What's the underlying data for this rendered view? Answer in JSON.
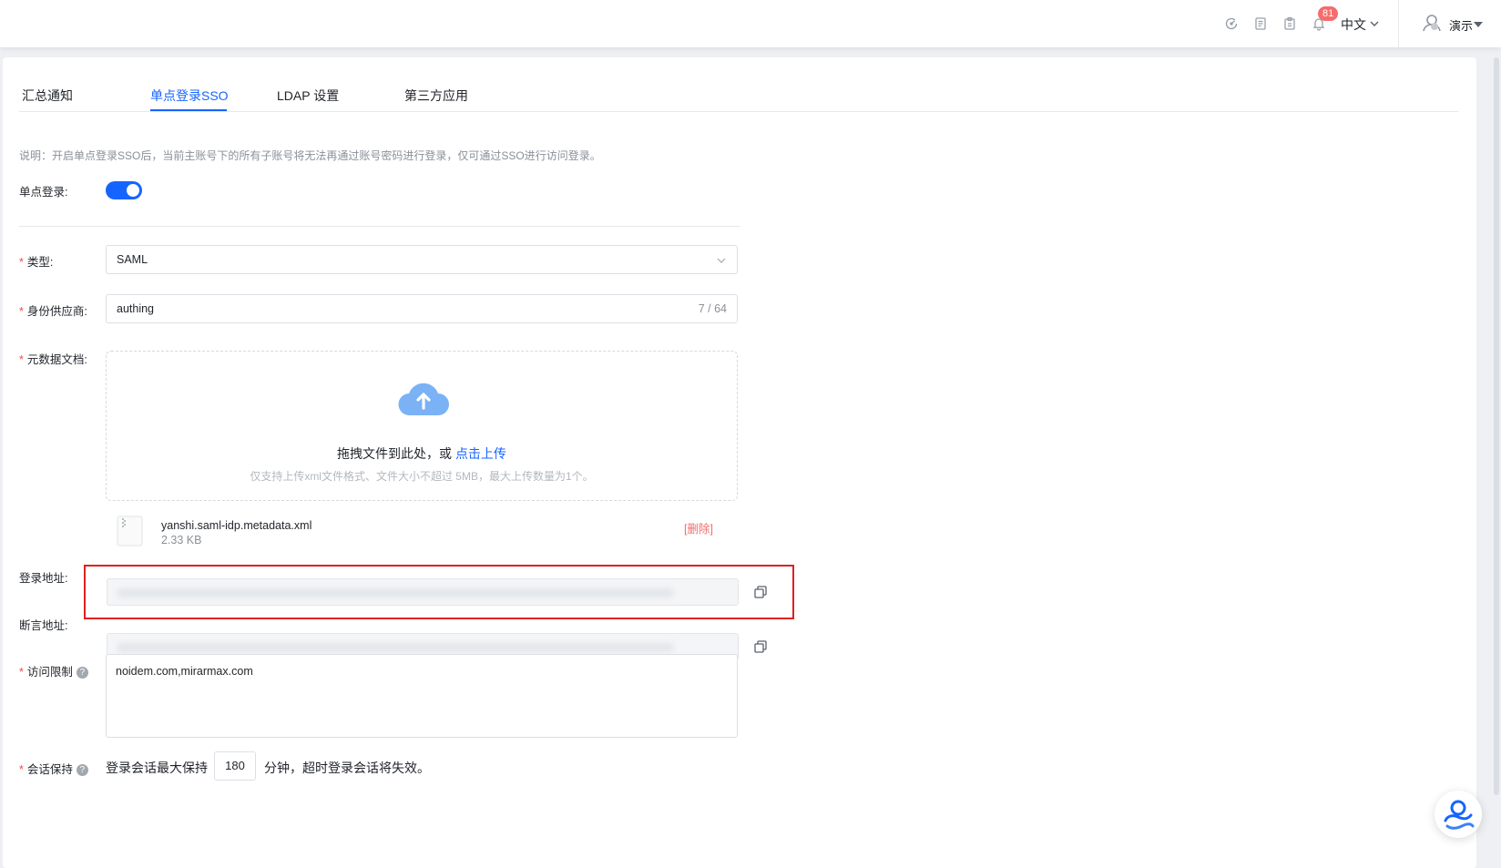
{
  "header": {
    "notification_count": "81",
    "language": "中文",
    "username": "演示",
    "icons": [
      "gauge-icon",
      "document-icon",
      "clipboard-icon",
      "bell-icon",
      "chevron-down-icon",
      "user-avatar-icon"
    ]
  },
  "tabs": [
    {
      "label": "汇总通知",
      "active": false
    },
    {
      "label": "单点登录SSO",
      "active": true
    },
    {
      "label": "LDAP 设置",
      "active": false
    },
    {
      "label": "第三方应用",
      "active": false
    }
  ],
  "form": {
    "note": "说明：开启单点登录SSO后，当前主账号下的所有子账号将无法再通过账号密码进行登录，仅可通过SSO进行访问登录。",
    "sso_label": "单点登录:",
    "sso_enabled": true,
    "type_label": "类型:",
    "type_value": "SAML",
    "idp_label": "身份供应商:",
    "idp_value": "authing",
    "idp_count": "7 / 64",
    "metadata_label": "元数据文档:",
    "upload_text": "拖拽文件到此处，或",
    "upload_link": "点击上传",
    "upload_hint": "仅支持上传xml文件格式、文件大小不超过 5MB，最大上传数量为1个。",
    "file_name": "yanshi.saml-idp.metadata.xml",
    "file_size": "2.33 KB",
    "file_delete": "[删除]",
    "login_url_label": "登录地址:",
    "assertion_url_label": "断言地址:",
    "access_label": "访问限制",
    "access_value": "noidem.com,mirarmax.com",
    "session_label": "会话保持",
    "session_prefix": "登录会话最大保持",
    "session_minutes": "180",
    "session_suffix": "分钟，超时登录会话将失效。",
    "required_mark": "*",
    "help_mark": "?"
  },
  "colors": {
    "primary": "#1664ff",
    "danger": "#f56c6c",
    "highlight_border": "#e02020"
  }
}
